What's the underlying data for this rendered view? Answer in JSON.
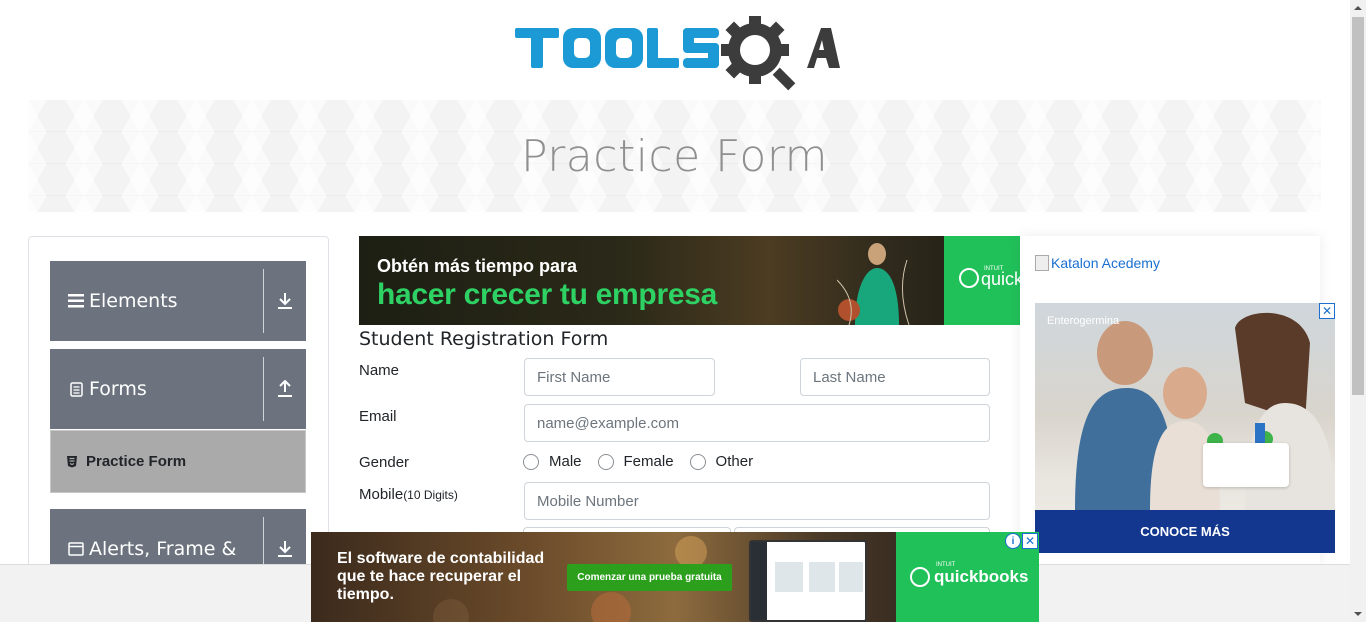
{
  "logo": {
    "text": "TOOLSQA",
    "colors": {
      "tools": "#1b9ad6",
      "qa": "#3c3c3c"
    }
  },
  "banner": {
    "title": "Practice Form"
  },
  "sidebar": {
    "groups": [
      {
        "label": "Elements",
        "icon": "hamburger-icon",
        "arrow": "download-arrow-icon"
      },
      {
        "label": "Forms",
        "icon": "document-icon",
        "arrow": "upload-arrow-icon"
      },
      {
        "label": "Alerts, Frame &",
        "icon": "window-icon",
        "arrow": "download-arrow-icon"
      }
    ],
    "active_item": {
      "label": "Practice Form",
      "icon": "html5-shield-icon"
    },
    "colors": {
      "group_bg": "#6c737e",
      "active_bg": "#aaaaaa"
    }
  },
  "ads": {
    "top": {
      "line1": "Obtén más tiempo para",
      "line2": "hacer crecer tu empresa",
      "brand": "quick",
      "intuit": "INTUIT"
    },
    "right": {
      "link_text": "Katalon Acedemy",
      "brand": "Enterogermina",
      "cta": "CONOCE MÁS",
      "close": "✕"
    },
    "bottom": {
      "text": "El software de contabilidad que te hace recuperar el tiempo.",
      "button": "Comenzar una prueba gratuita",
      "brand": "quickbooks",
      "intuit": "INTUIT",
      "adchoices": "i",
      "close": "✕"
    }
  },
  "form": {
    "title": "Student Registration Form",
    "name_label": "Name",
    "first_name_placeholder": "First Name",
    "last_name_placeholder": "Last Name",
    "email_label": "Email",
    "email_placeholder": "name@example.com",
    "gender_label": "Gender",
    "gender_options": [
      "Male",
      "Female",
      "Other"
    ],
    "mobile_label": "Mobile",
    "mobile_hint": "(10 Digits)",
    "mobile_placeholder": "Mobile Number"
  }
}
